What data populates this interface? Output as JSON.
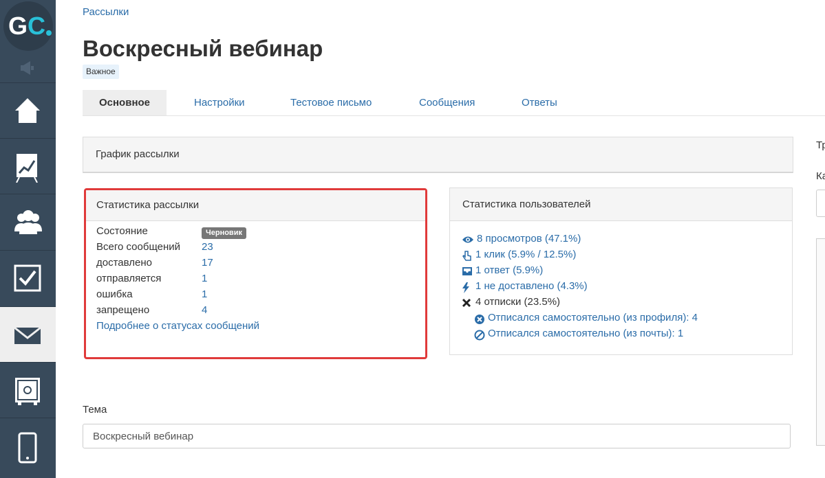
{
  "sidebar": {
    "logo_text": "GC",
    "items": [
      "megaphone",
      "home",
      "analytics",
      "users",
      "tasks",
      "mail",
      "safe",
      "mobile"
    ]
  },
  "breadcrumb": "Рассылки",
  "page_title": "Воскресный вебинар",
  "tag": "Важное",
  "tabs": [
    "Основное",
    "Настройки",
    "Тестовое письмо",
    "Сообщения",
    "Ответы"
  ],
  "graph_panel_title": "График рассылки",
  "mailing_stats": {
    "title": "Статистика рассылки",
    "rows": [
      {
        "label": "Состояние",
        "value": "Черновик"
      },
      {
        "label": "Всего сообщений",
        "value": "23"
      },
      {
        "label": "доставлено",
        "value": "17"
      },
      {
        "label": "отправляется",
        "value": "1"
      },
      {
        "label": "ошибка",
        "value": "1"
      },
      {
        "label": "запрещено",
        "value": "4"
      }
    ],
    "details_link": "Подробнее о статусах сообщений"
  },
  "user_stats": {
    "title": "Статистика пользователей",
    "rows": [
      {
        "icon": "eye-icon",
        "text": "8 просмотров (47.1%)",
        "link": true
      },
      {
        "icon": "pointer-icon",
        "text": "1 клик (5.9% / 12.5%)",
        "link": true
      },
      {
        "icon": "inbox-icon",
        "text": "1 ответ (5.9%)",
        "link": true
      },
      {
        "icon": "bolt-icon",
        "text": "1 не доставлено (4.3%)",
        "link": true
      },
      {
        "icon": "times-icon",
        "text": "4 отписки (23.5%)",
        "link": false
      },
      {
        "icon": "minus-circle-icon",
        "text": "Отписался самостоятельно (из профиля): 4",
        "link": true
      },
      {
        "icon": "ban-icon",
        "text": "Отписался самостоятельно (из почты): 1",
        "link": true
      }
    ]
  },
  "topic": {
    "label": "Тема",
    "value": "Воскресный вебинар"
  },
  "right_column": {
    "fragment_1": "Тр",
    "fragment_2": "Ка"
  },
  "colors": {
    "sidebar_bg": "#384a5b",
    "link": "#2a6ca8",
    "highlight_border": "#e03a3a",
    "logo_accent": "#29c0d8"
  }
}
